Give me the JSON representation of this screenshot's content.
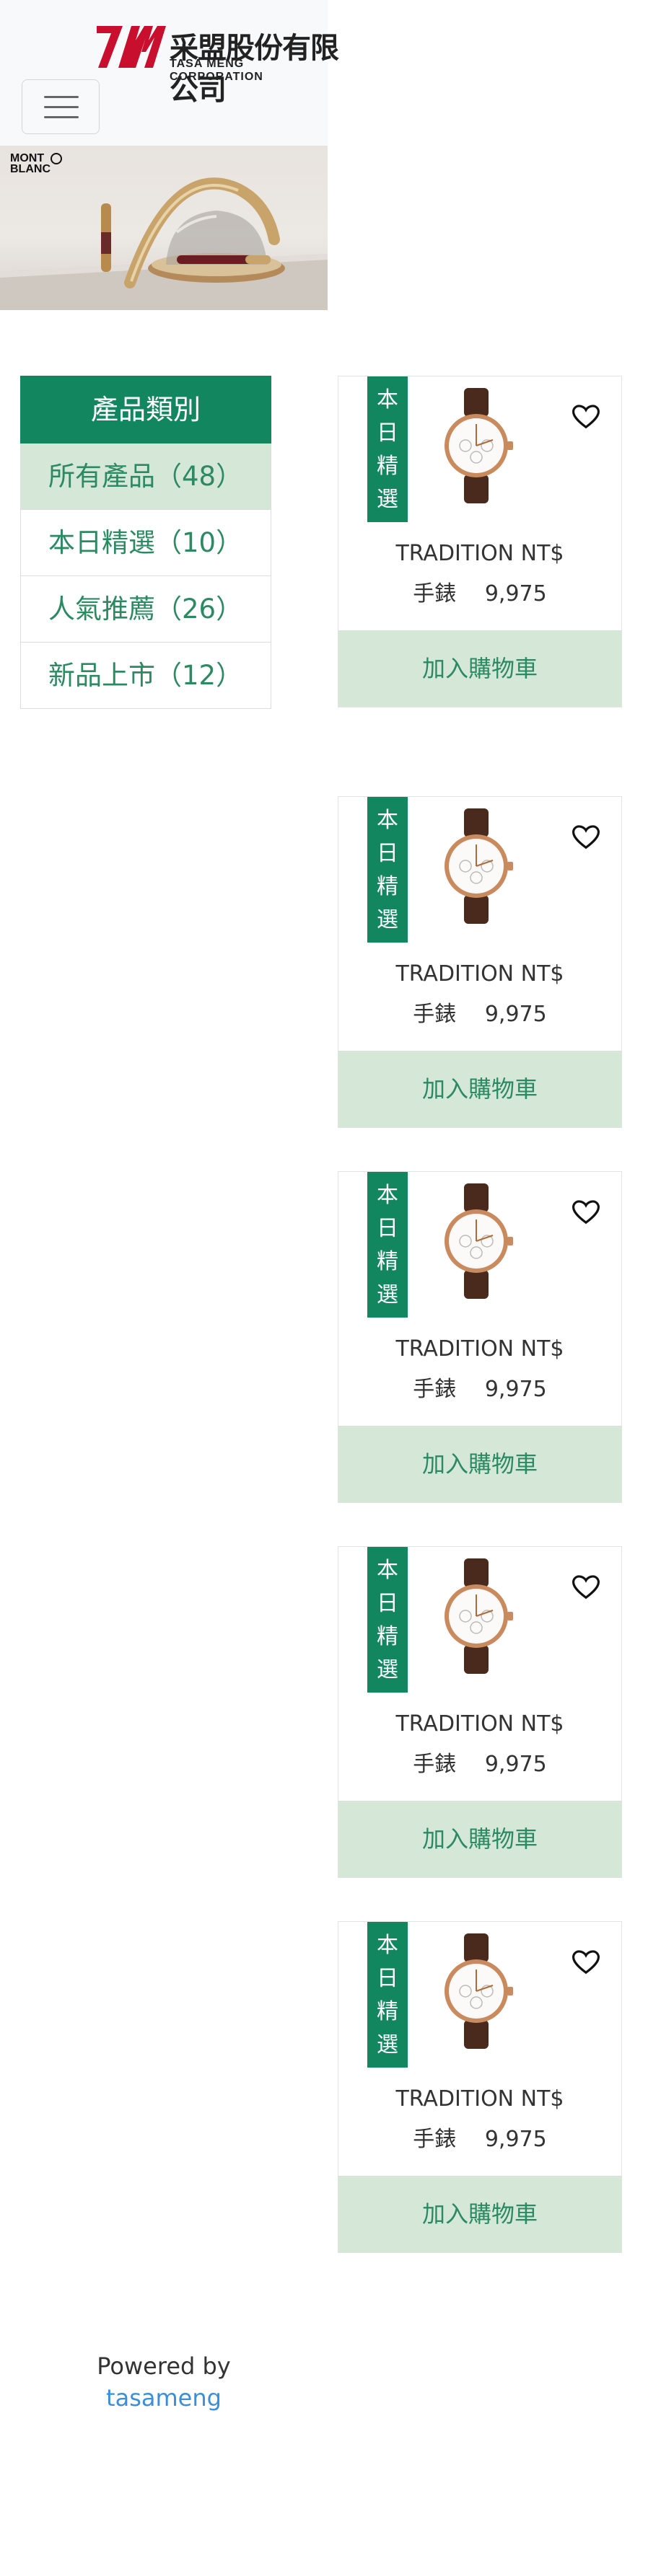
{
  "header": {
    "logo_cn": "采盟股份有限公司",
    "logo_en": "TASA MENG CORPORATION"
  },
  "banner": {
    "brand_line1": "MONT",
    "brand_line2": "BLANC"
  },
  "sidebar": {
    "title": "產品類別",
    "items": [
      {
        "label": "所有產品（48）"
      },
      {
        "label": "本日精選（10）"
      },
      {
        "label": "人氣推薦（26）"
      },
      {
        "label": "新品上市（12）"
      }
    ]
  },
  "products": [
    {
      "badge": [
        "本",
        "日",
        "精",
        "選"
      ],
      "name": "TRADITION NT$",
      "price": "手錶　 9,975",
      "cart_label": "加入購物車"
    },
    {
      "badge": [
        "本",
        "日",
        "精",
        "選"
      ],
      "name": "TRADITION NT$",
      "price": "手錶　 9,975",
      "cart_label": "加入購物車"
    },
    {
      "badge": [
        "本",
        "日",
        "精",
        "選"
      ],
      "name": "TRADITION NT$",
      "price": "手錶　 9,975",
      "cart_label": "加入購物車"
    },
    {
      "badge": [
        "本",
        "日",
        "精",
        "選"
      ],
      "name": "TRADITION NT$",
      "price": "手錶　 9,975",
      "cart_label": "加入購物車"
    },
    {
      "badge": [
        "本",
        "日",
        "精",
        "選"
      ],
      "name": "TRADITION NT$",
      "price": "手錶　 9,975",
      "cart_label": "加入購物車"
    }
  ],
  "footer": {
    "powered_by": "Powered by",
    "link": "tasameng"
  },
  "colors": {
    "brand_green": "#12875f",
    "light_green": "#d5e8d8",
    "link_blue": "#3b8fd9"
  }
}
